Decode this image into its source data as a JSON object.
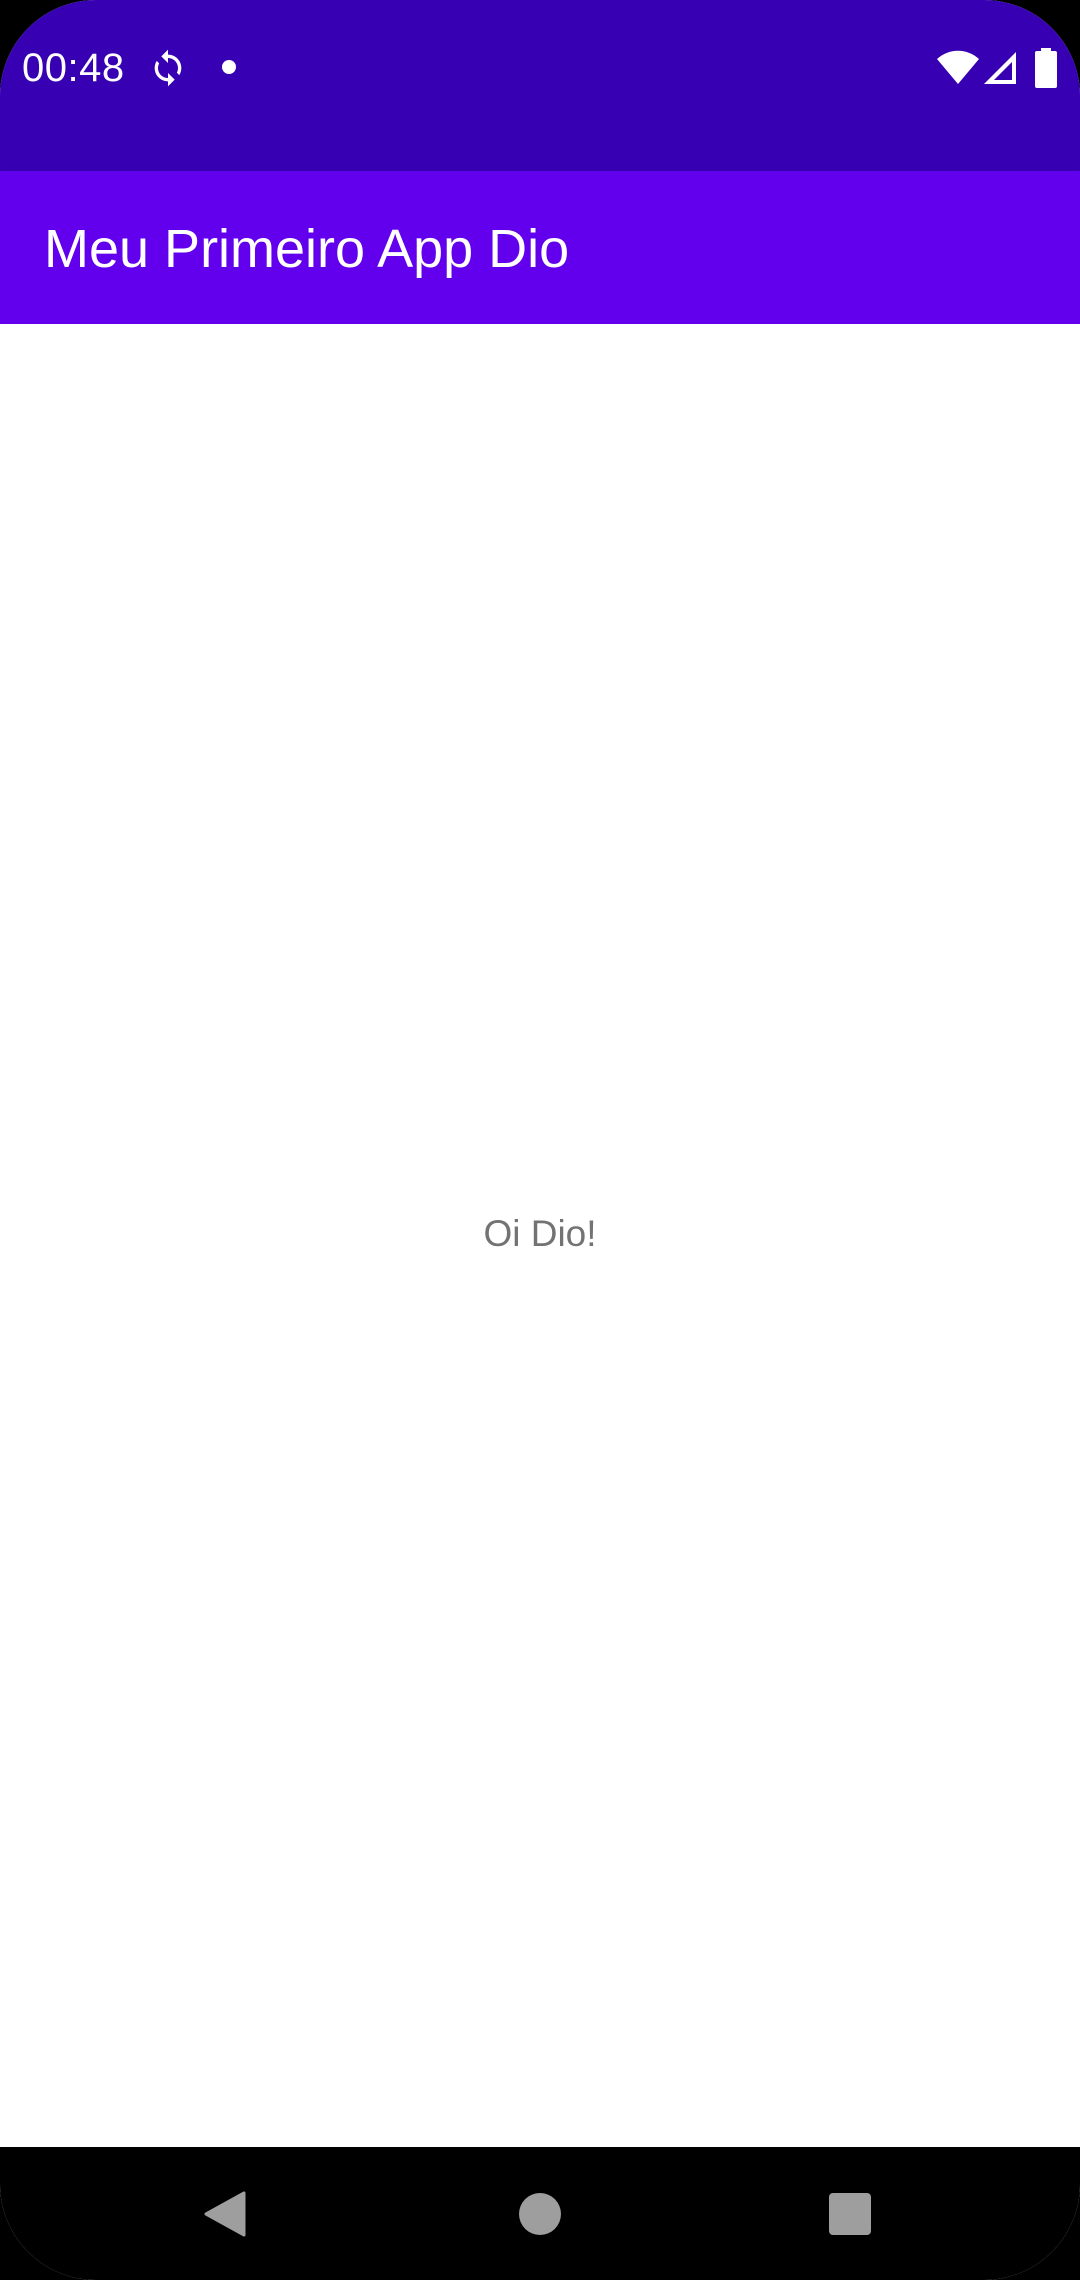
{
  "status_bar": {
    "time": "00:48",
    "icons": [
      "sync-icon",
      "notification-dot-icon",
      "wifi-icon",
      "cell-signal-icon",
      "battery-icon"
    ],
    "background_color": "#3700B3"
  },
  "app_bar": {
    "title": "Meu Primeiro App Dio",
    "background_color": "#6200EE"
  },
  "main": {
    "greeting": "Oi Dio!"
  },
  "nav_bar": {
    "icons": [
      "back-icon",
      "home-icon",
      "recents-icon"
    ]
  }
}
